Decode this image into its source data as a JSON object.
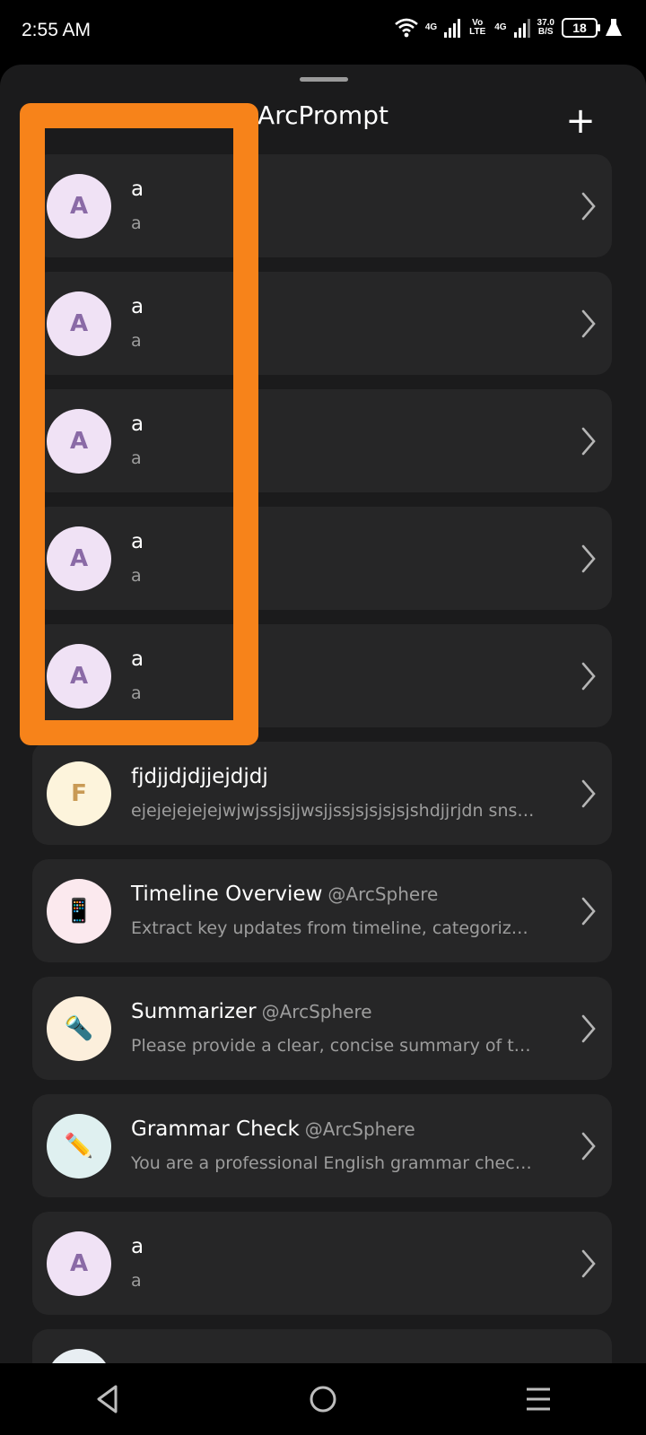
{
  "status": {
    "time": "2:55 AM",
    "net1": "4G",
    "volte": "Vo LTE",
    "net2": "4G",
    "speed_value": "37.0",
    "speed_unit": "B/S",
    "battery": "18"
  },
  "header": {
    "title": "ArcPrompt",
    "add_label": "+"
  },
  "items": [
    {
      "initial": "A",
      "title": "a",
      "author": "",
      "desc": "a",
      "avatar_bg": "#f0e2f5",
      "avatar_fg": "#8a6aa6"
    },
    {
      "initial": "A",
      "title": "a",
      "author": "",
      "desc": "a",
      "avatar_bg": "#f0e2f5",
      "avatar_fg": "#8a6aa6"
    },
    {
      "initial": "A",
      "title": "a",
      "author": "",
      "desc": "a",
      "avatar_bg": "#f0e2f5",
      "avatar_fg": "#8a6aa6"
    },
    {
      "initial": "A",
      "title": "a",
      "author": "",
      "desc": "a",
      "avatar_bg": "#f0e2f5",
      "avatar_fg": "#8a6aa6"
    },
    {
      "initial": "A",
      "title": "a",
      "author": "",
      "desc": "a",
      "avatar_bg": "#f0e2f5",
      "avatar_fg": "#8a6aa6"
    },
    {
      "initial": "F",
      "title": "fjdjjdjdjjejdjdj",
      "author": "",
      "desc": "ejejejejejejwjwjssjsjjwsjjssjsjsjsjsjshdjjrjdn sns…",
      "avatar_bg": "#fdf4dc",
      "avatar_fg": "#c99a55"
    },
    {
      "initial": "📱",
      "title": "Timeline Overview",
      "author": "@ArcSphere",
      "desc": "Extract key updates from timeline, categoriz…",
      "avatar_bg": "#fbe9ee",
      "avatar_fg": "#333333"
    },
    {
      "initial": "🔦",
      "title": "Summarizer",
      "author": "@ArcSphere",
      "desc": "Please provide a clear, concise summary of t…",
      "avatar_bg": "#fcefdc",
      "avatar_fg": "#333333"
    },
    {
      "initial": "✏️",
      "title": "Grammar Check",
      "author": "@ArcSphere",
      "desc": "You are a professional English grammar chec…",
      "avatar_bg": "#dff0f0",
      "avatar_fg": "#333333"
    },
    {
      "initial": "A",
      "title": "a",
      "author": "",
      "desc": "a",
      "avatar_bg": "#f0e2f5",
      "avatar_fg": "#8a6aa6"
    },
    {
      "initial": "",
      "title": "",
      "author": "",
      "desc": "",
      "avatar_bg": "#e8eef2",
      "avatar_fg": "#333333"
    }
  ],
  "colors": {
    "highlight": "#f7831a",
    "card": "#262627",
    "sheet": "#1b1b1c"
  }
}
